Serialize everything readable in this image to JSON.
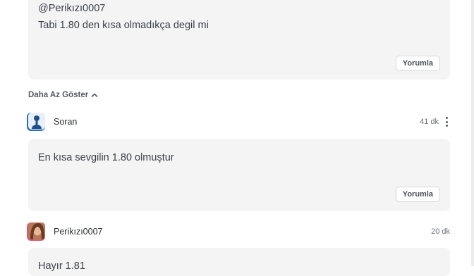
{
  "comments": [
    {
      "mention": "@Perikızı0007",
      "text": "Tabi 1.80 den kısa olmadıkça degil mi",
      "reply_label": "Yorumla"
    },
    {
      "author": "Soran",
      "time": "41 dk",
      "text": "En kısa sevgilin 1.80 olmuştur",
      "reply_label": "Yorumla"
    },
    {
      "author": "Perikızı0007",
      "time": "20 dk",
      "text": "Hayır 1.81"
    }
  ],
  "toggle_label": "Daha Az Göster",
  "icons": {
    "toggle": "chevron-up-icon",
    "menu": "more-vertical-icon"
  }
}
